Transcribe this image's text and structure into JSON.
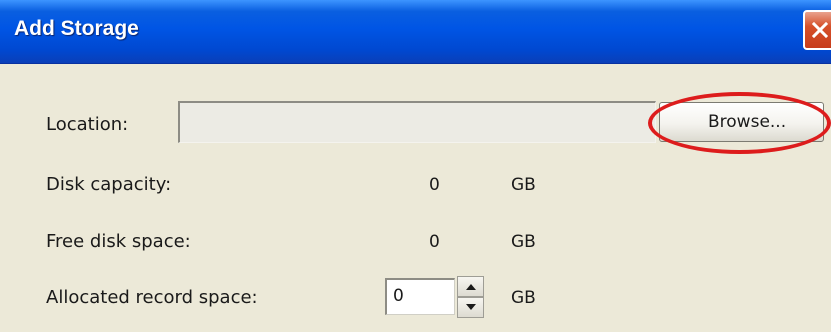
{
  "dialog": {
    "title": "Add Storage",
    "close_icon": "close-icon"
  },
  "location": {
    "label": "Location:",
    "value": "",
    "browse_label": "Browse..."
  },
  "disk_capacity": {
    "label": "Disk capacity:",
    "value": "0",
    "unit": "GB"
  },
  "free_disk_space": {
    "label": "Free disk space:",
    "value": "0",
    "unit": "GB"
  },
  "allocated_record_space": {
    "label": "Allocated record space:",
    "value": "0",
    "unit": "GB",
    "spin_up_icon": "arrow-up-icon",
    "spin_down_icon": "arrow-down-icon"
  },
  "colors": {
    "titlebar": "#0055e5",
    "dialog_bg": "#ece9d8",
    "close_button": "#c73c1a",
    "annotation_circle": "#dd1c1c"
  }
}
